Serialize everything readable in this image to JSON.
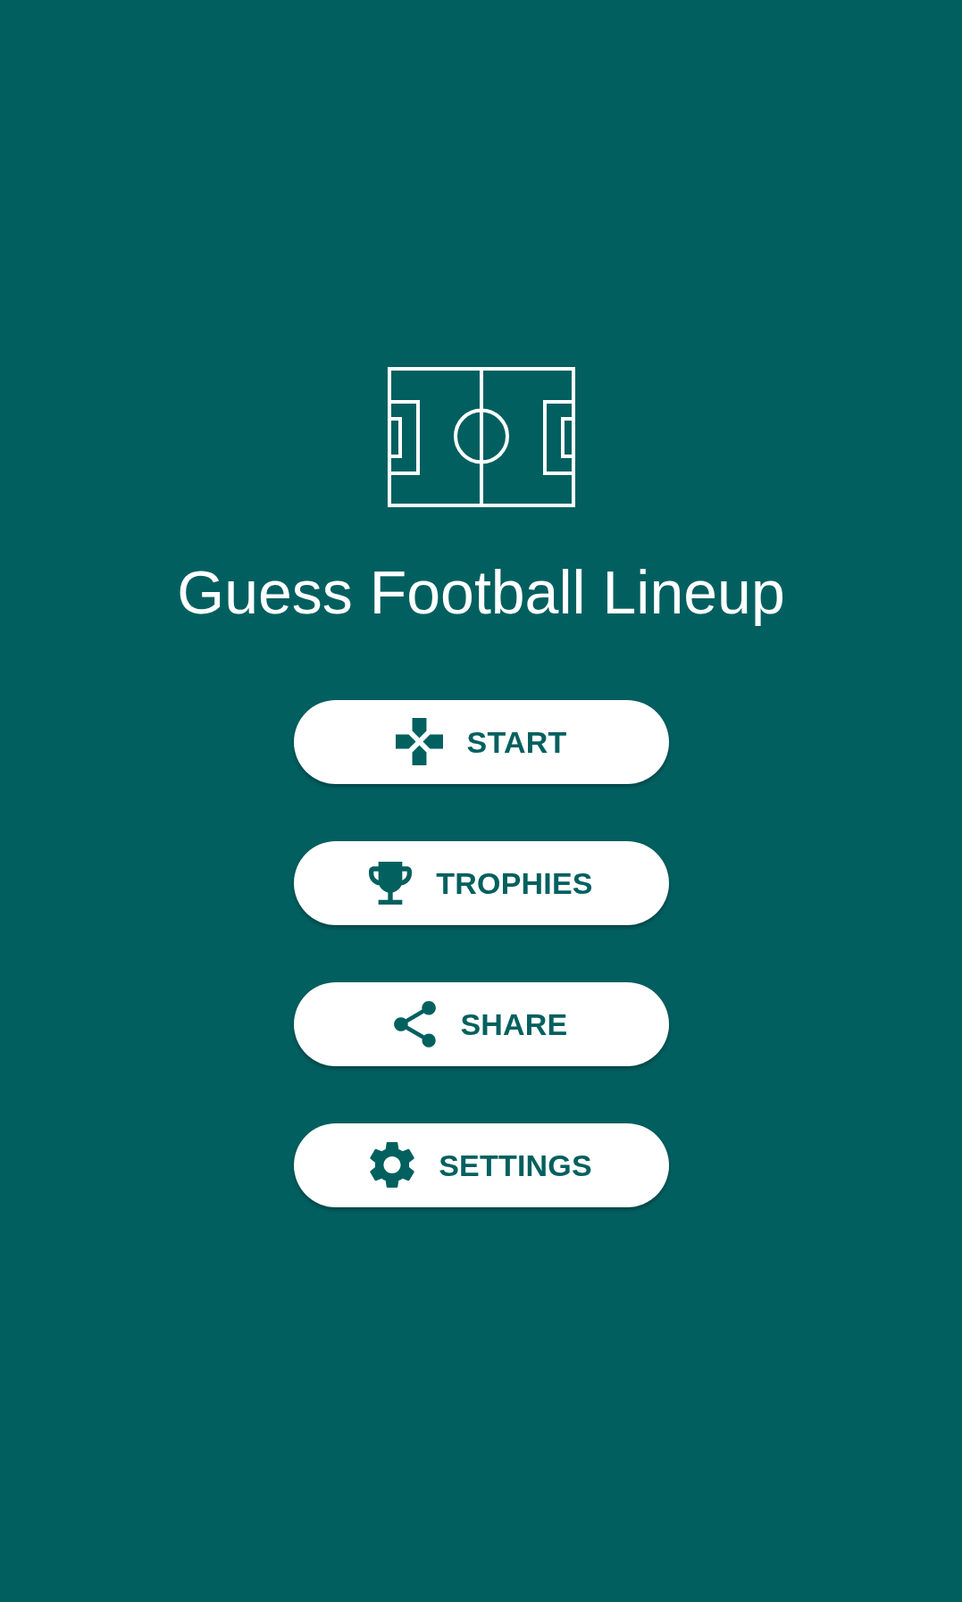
{
  "app": {
    "title": "Guess Football Lineup"
  },
  "menu": [
    {
      "kind": "start",
      "label": "START"
    },
    {
      "kind": "trophies",
      "label": "TROPHIES"
    },
    {
      "kind": "share",
      "label": "SHARE"
    },
    {
      "kind": "settings",
      "label": "SETTINGS"
    }
  ]
}
